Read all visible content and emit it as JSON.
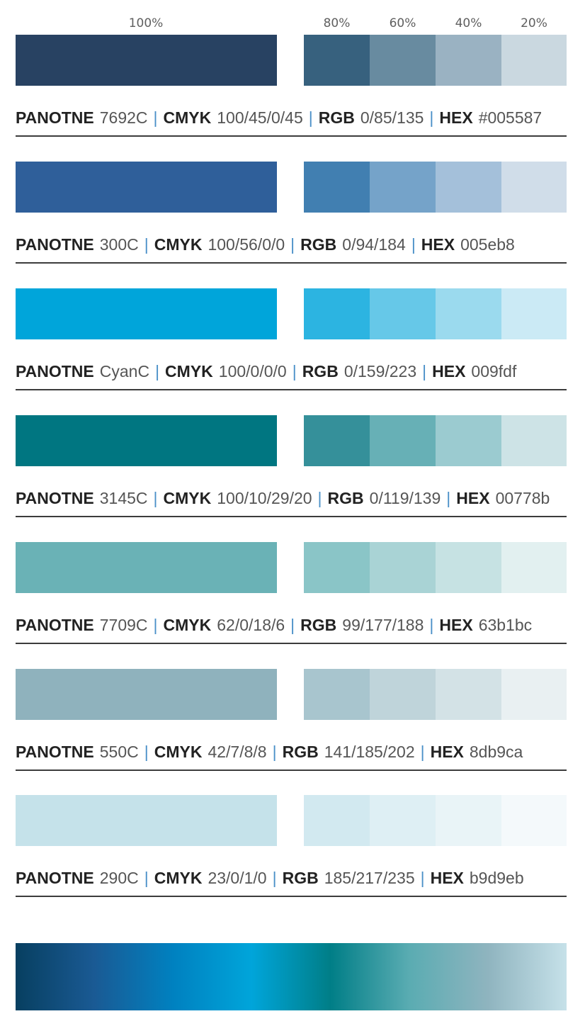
{
  "header": {
    "tints": [
      "100%",
      "80%",
      "60%",
      "40%",
      "20%"
    ]
  },
  "labels": {
    "pantone": "PANOTNE",
    "cmyk": "CMYK",
    "rgb": "RGB",
    "hex": "HEX",
    "separator": "|"
  },
  "swatches": [
    {
      "pantone": "7692C",
      "cmyk": "100/45/0/45",
      "rgb": "0/85/135",
      "hex": "#005587",
      "color": "#284262",
      "tint_colors": [
        "#37617e",
        "#688ba0",
        "#9ab2c2",
        "#cad8e0"
      ]
    },
    {
      "pantone": "300C",
      "cmyk": "100/56/0/0",
      "rgb": "0/94/184",
      "hex": "005eb8",
      "color": "#2f5f9a",
      "tint_colors": [
        "#417fb1",
        "#75a3c9",
        "#a4c0da",
        "#d0dde9"
      ]
    },
    {
      "pantone": "CyanC",
      "cmyk": "100/0/0/0",
      "rgb": "0/159/223",
      "hex": "009fdf",
      "color": "#00a5da",
      "tint_colors": [
        "#2cb4e1",
        "#66c8e8",
        "#9bdaee",
        "#cbeaf5"
      ]
    },
    {
      "pantone": "3145C",
      "cmyk": "100/10/29/20",
      "rgb": "0/119/139",
      "hex": "00778b",
      "color": "#007681",
      "tint_colors": [
        "#35909a",
        "#67b0b6",
        "#9bcbd0",
        "#cde3e6"
      ]
    },
    {
      "pantone": "7709C",
      "cmyk": "62/0/18/6",
      "rgb": "99/177/188",
      "hex": "63b1bc",
      "color": "#6ab2b6",
      "tint_colors": [
        "#8ac5c7",
        "#a9d3d5",
        "#c6e2e3",
        "#e2f0f0"
      ]
    },
    {
      "pantone": "550C",
      "cmyk": "42/7/8/8",
      "rgb": "141/185/202",
      "hex": "8db9ca",
      "color": "#8fb2bd",
      "tint_colors": [
        "#a8c5ce",
        "#bfd4da",
        "#d3e2e6",
        "#e9f0f2"
      ]
    },
    {
      "pantone": "290C",
      "cmyk": "23/0/1/0",
      "rgb": "185/217/235",
      "hex": "b9d9eb",
      "color": "#c5e2ea",
      "tint_colors": [
        "#d2e9f0",
        "#deeff4",
        "#e9f4f7",
        "#f4f9fb"
      ]
    }
  ],
  "gradient": {
    "stops": [
      "#073f60",
      "#1a5a94",
      "#0081c0",
      "#00a5da",
      "#007e87",
      "#5aacb2",
      "#8fb4bf",
      "#c6e1e9"
    ]
  }
}
